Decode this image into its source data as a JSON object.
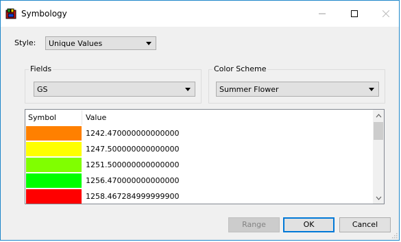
{
  "window": {
    "title": "Symbology"
  },
  "style": {
    "label": "Style:",
    "value": "Unique Values"
  },
  "fields": {
    "label": "Fields",
    "value": "GS"
  },
  "color_scheme": {
    "label": "Color Scheme",
    "value": "Summer Flower"
  },
  "table": {
    "headers": {
      "symbol": "Symbol",
      "value": "Value"
    },
    "rows": [
      {
        "color": "#ff8000",
        "value": "1242.470000000000000"
      },
      {
        "color": "#ffff00",
        "value": "1247.500000000000000"
      },
      {
        "color": "#80ff00",
        "value": "1251.500000000000000"
      },
      {
        "color": "#00ff00",
        "value": "1256.470000000000000"
      },
      {
        "color": "#ff0000",
        "value": "1258.467284999999900"
      }
    ]
  },
  "buttons": {
    "range": "Range",
    "ok": "OK",
    "cancel": "Cancel"
  }
}
